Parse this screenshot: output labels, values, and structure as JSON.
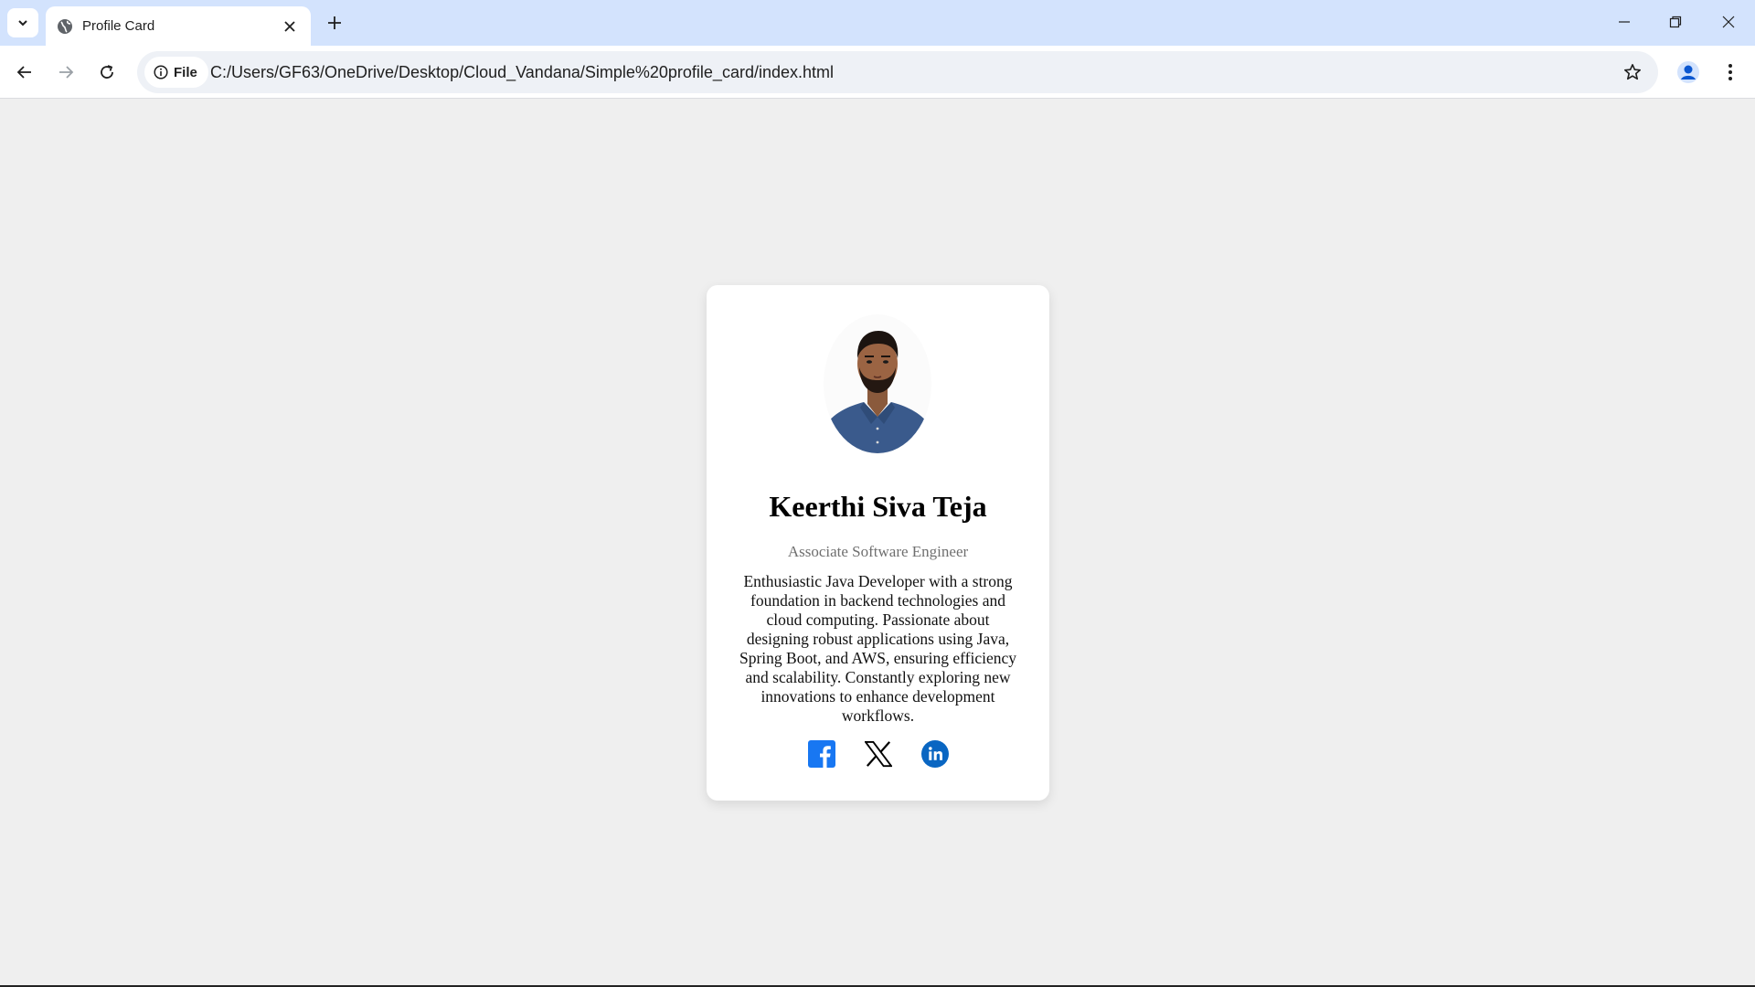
{
  "browser": {
    "tab_title": "Profile Card",
    "site_chip_label": "File",
    "url": "C:/Users/GF63/OneDrive/Desktop/Cloud_Vandana/Simple%20profile_card/index.html"
  },
  "profile": {
    "name": "Keerthi Siva Teja",
    "role": "Associate Software Engineer",
    "bio": "Enthusiastic Java Developer with a strong foundation in backend technologies and cloud computing. Passionate about designing robust applications using Java, Spring Boot, and AWS, ensuring efficiency and scalability. Constantly exploring new innovations to enhance development workflows.",
    "socials": [
      {
        "icon": "facebook-icon",
        "color": "#1877f2"
      },
      {
        "icon": "x-icon",
        "color": "#000000"
      },
      {
        "icon": "linkedin-icon",
        "color": "#0a66c2"
      }
    ]
  },
  "colors": {
    "page_bg": "#efefef",
    "tabbar_bg": "#d3e3fd",
    "card_bg": "#ffffff",
    "shirt": "#3a5a8c"
  }
}
